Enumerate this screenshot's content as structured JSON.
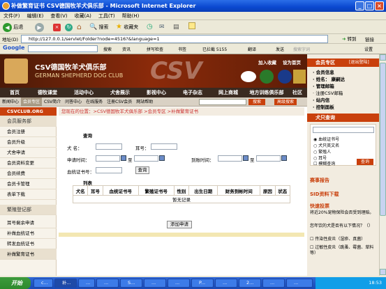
{
  "window": {
    "title": "补做繁育证书 CSV德国牧羊犬俱乐部 - Microsoft Internet Explorer",
    "min": "_",
    "max": "□",
    "close": "×"
  },
  "menu": [
    "文件(F)",
    "编辑(E)",
    "查看(V)",
    "收藏(A)",
    "工具(T)",
    "帮助(H)"
  ],
  "toolbar": {
    "back": "后退",
    "search": "搜索",
    "favorites": "收藏夹"
  },
  "address": {
    "label": "地址(D)",
    "url": "http://127.0.0.1/servlet/Folder?node=4516?&language=1",
    "go": "转到",
    "links": "链接"
  },
  "googlebar": {
    "brand": "Google",
    "label1": "搜索",
    "label2": "资讯",
    "label3": "拼写检查",
    "label4": "书签",
    "blocked": "已拦截 5155",
    "translate": "翻译",
    "send": "发送",
    "search_hint": "搜索字词",
    "settings": "设置"
  },
  "site": {
    "banner_title": "CSV德国牧羊犬俱乐部",
    "banner_sub": "GERMAN SHEPHERD DOG CLUB",
    "banner_big": "CSV",
    "top_link_join": "加入收藏",
    "top_link_home": "设为首页",
    "mainnav": [
      "首页",
      "德牧课堂",
      "活动中心",
      "犬舍展示",
      "影视中心",
      "电子杂志",
      "网上商城",
      "地方训练俱乐部",
      "社区"
    ],
    "subnav": [
      "新闻中心",
      "会员专区",
      "CSV简介",
      "问答中心",
      "在线服务",
      "注册CSV会员",
      "网站帮助"
    ],
    "subnav_search": "搜索",
    "subnav_adv": "高级搜索",
    "left_brand": "CSVCLUB.ORG",
    "left_menu": [
      "会员服务部",
      "会员注册",
      "会员升级",
      "犬舍申请",
      "会员资料变更",
      "会员续费",
      "会员卡管理",
      "表单下载",
      "繁殖登记部",
      "耳号剩余申请",
      "补做血统证书",
      "转发血统证书",
      "补做繁育证书"
    ],
    "crumb": "您现在的位置：>CSV德国牧羊犬俱乐部 >会员专区 >补做繁育证书",
    "query_title": "查询",
    "kennel_label": "犬 名：",
    "ear_label": "耳号：",
    "apply_time_label": "申请时间：",
    "to": "至",
    "arrive_time_label": "到账时间：",
    "pedigree_label": "血统证书号：",
    "query_btn": "查询",
    "table_title": "列表",
    "columns": [
      "犬名",
      "耳号",
      "血统证书号",
      "繁殖证书号",
      "性别",
      "出生日期",
      "财务到帐时间",
      "原因",
      "状态"
    ],
    "empty": "暂无记录",
    "add_btn": "添加申请"
  },
  "right": {
    "member_head": "会员专区",
    "logout": "[退出登陆]",
    "member_rows": [
      "· 会员信息",
      "· 姓名： 康嗣达",
      "· 管理邮箱",
      "· 注册CSV邮箱",
      "· 站内信",
      "· 控制面板"
    ],
    "dog_head": "犬只查询",
    "radios": [
      "血统证书号",
      "犬只英文名",
      "繁殖人",
      "耳号",
      "模糊查询"
    ],
    "dog_btn": "查询",
    "news_head": "赛事报告",
    "sid_head": "SID资料下载",
    "poll_head": "快速投票",
    "poll_text": "将近20%宠物保险会否受到理赔。",
    "poll_q": "您年饮的犬是否有以下情况？（）",
    "poll_opt1": "传染性皮炎（湿疹、真菌）",
    "poll_opt2": "过敏性皮炎（跳蚤、霉菌、草料等）"
  },
  "status": {
    "text": ""
  },
  "taskbar": {
    "start": "开始",
    "tasks": [
      "c...",
      "补...",
      "...",
      "...",
      "S...",
      "...",
      "...",
      "P...",
      "...",
      "2...",
      "...",
      "..."
    ],
    "clock": "18:53"
  },
  "colors": {
    "accent": "#c9400c",
    "titlebar": "#0a48d0",
    "crumb": "#cc3333"
  }
}
